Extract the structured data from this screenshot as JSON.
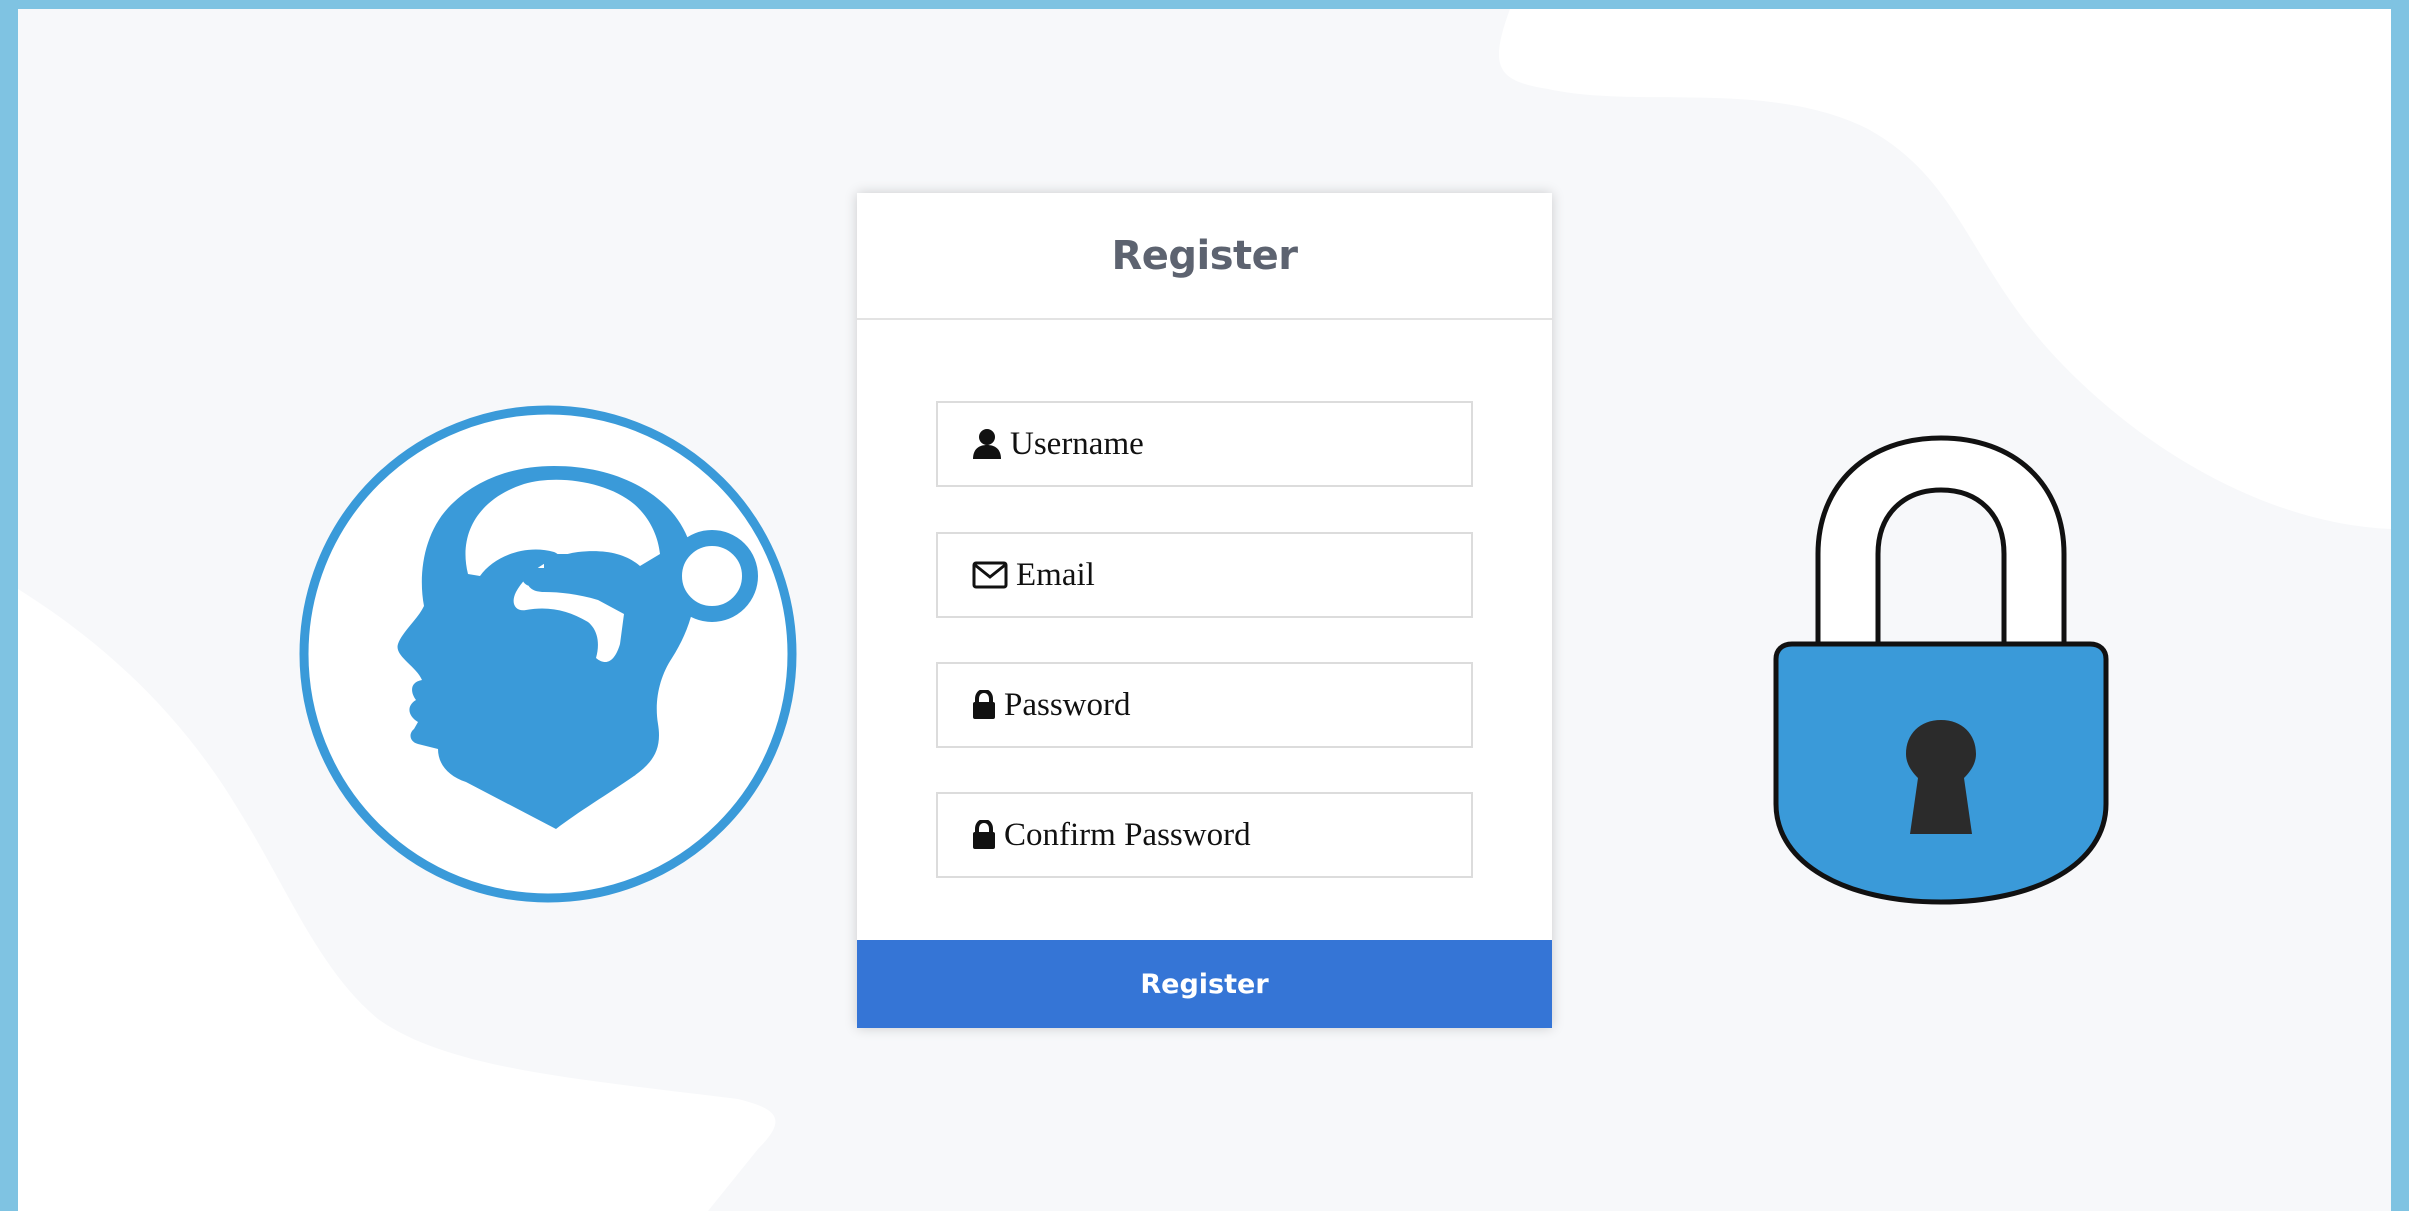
{
  "form": {
    "title": "Register",
    "fields": [
      {
        "icon": "user-icon",
        "placeholder": "Username",
        "value": ""
      },
      {
        "icon": "envelope-icon",
        "placeholder": "Email",
        "value": ""
      },
      {
        "icon": "lock-icon",
        "placeholder": "Password",
        "value": ""
      },
      {
        "icon": "lock-icon",
        "placeholder": "Confirm Password",
        "value": ""
      }
    ],
    "submit_label": "Register"
  },
  "colors": {
    "accent": "#3575d6",
    "logo_blue": "#3a9ad9",
    "frame_border": "#7fc3e2",
    "background": "#f7f8fa",
    "title_text": "#5d6370"
  },
  "illustrations": {
    "left": "head-key-icon",
    "right": "padlock-icon"
  }
}
